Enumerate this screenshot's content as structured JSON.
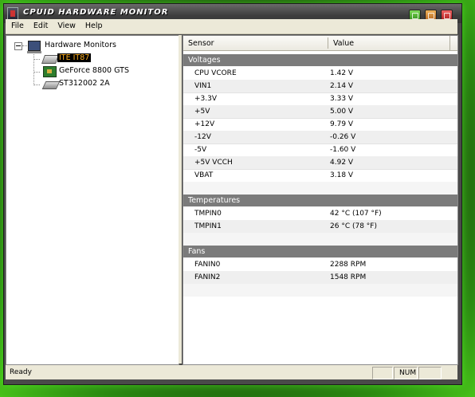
{
  "window": {
    "title": "CPUID HARDWARE MONITOR"
  },
  "menu": [
    "File",
    "Edit",
    "View",
    "Help"
  ],
  "tree": {
    "root": "Hardware Monitors",
    "children": [
      "ITE IT87",
      "GeForce 8800 GTS",
      "ST312002 2A"
    ],
    "selected_index": 0
  },
  "list": {
    "columns": [
      "Sensor",
      "Value"
    ],
    "sections": [
      {
        "name": "Voltages",
        "rows": [
          {
            "sensor": "CPU VCORE",
            "value": "1.42 V"
          },
          {
            "sensor": "VIN1",
            "value": "2.14 V"
          },
          {
            "sensor": "+3.3V",
            "value": "3.33 V"
          },
          {
            "sensor": "+5V",
            "value": "5.00 V"
          },
          {
            "sensor": "+12V",
            "value": "9.79 V"
          },
          {
            "sensor": "-12V",
            "value": "-0.26 V"
          },
          {
            "sensor": "-5V",
            "value": "-1.60 V"
          },
          {
            "sensor": "+5V VCCH",
            "value": "4.92 V"
          },
          {
            "sensor": "VBAT",
            "value": "3.18 V"
          }
        ]
      },
      {
        "name": "Temperatures",
        "rows": [
          {
            "sensor": "TMPIN0",
            "value": "42 °C (107 °F)"
          },
          {
            "sensor": "TMPIN1",
            "value": "26 °C (78 °F)"
          }
        ]
      },
      {
        "name": "Fans",
        "rows": [
          {
            "sensor": "FANIN0",
            "value": "2288 RPM"
          },
          {
            "sensor": "FANIN2",
            "value": "1548 RPM"
          }
        ]
      }
    ]
  },
  "status": {
    "text": "Ready",
    "num": "NUM"
  }
}
